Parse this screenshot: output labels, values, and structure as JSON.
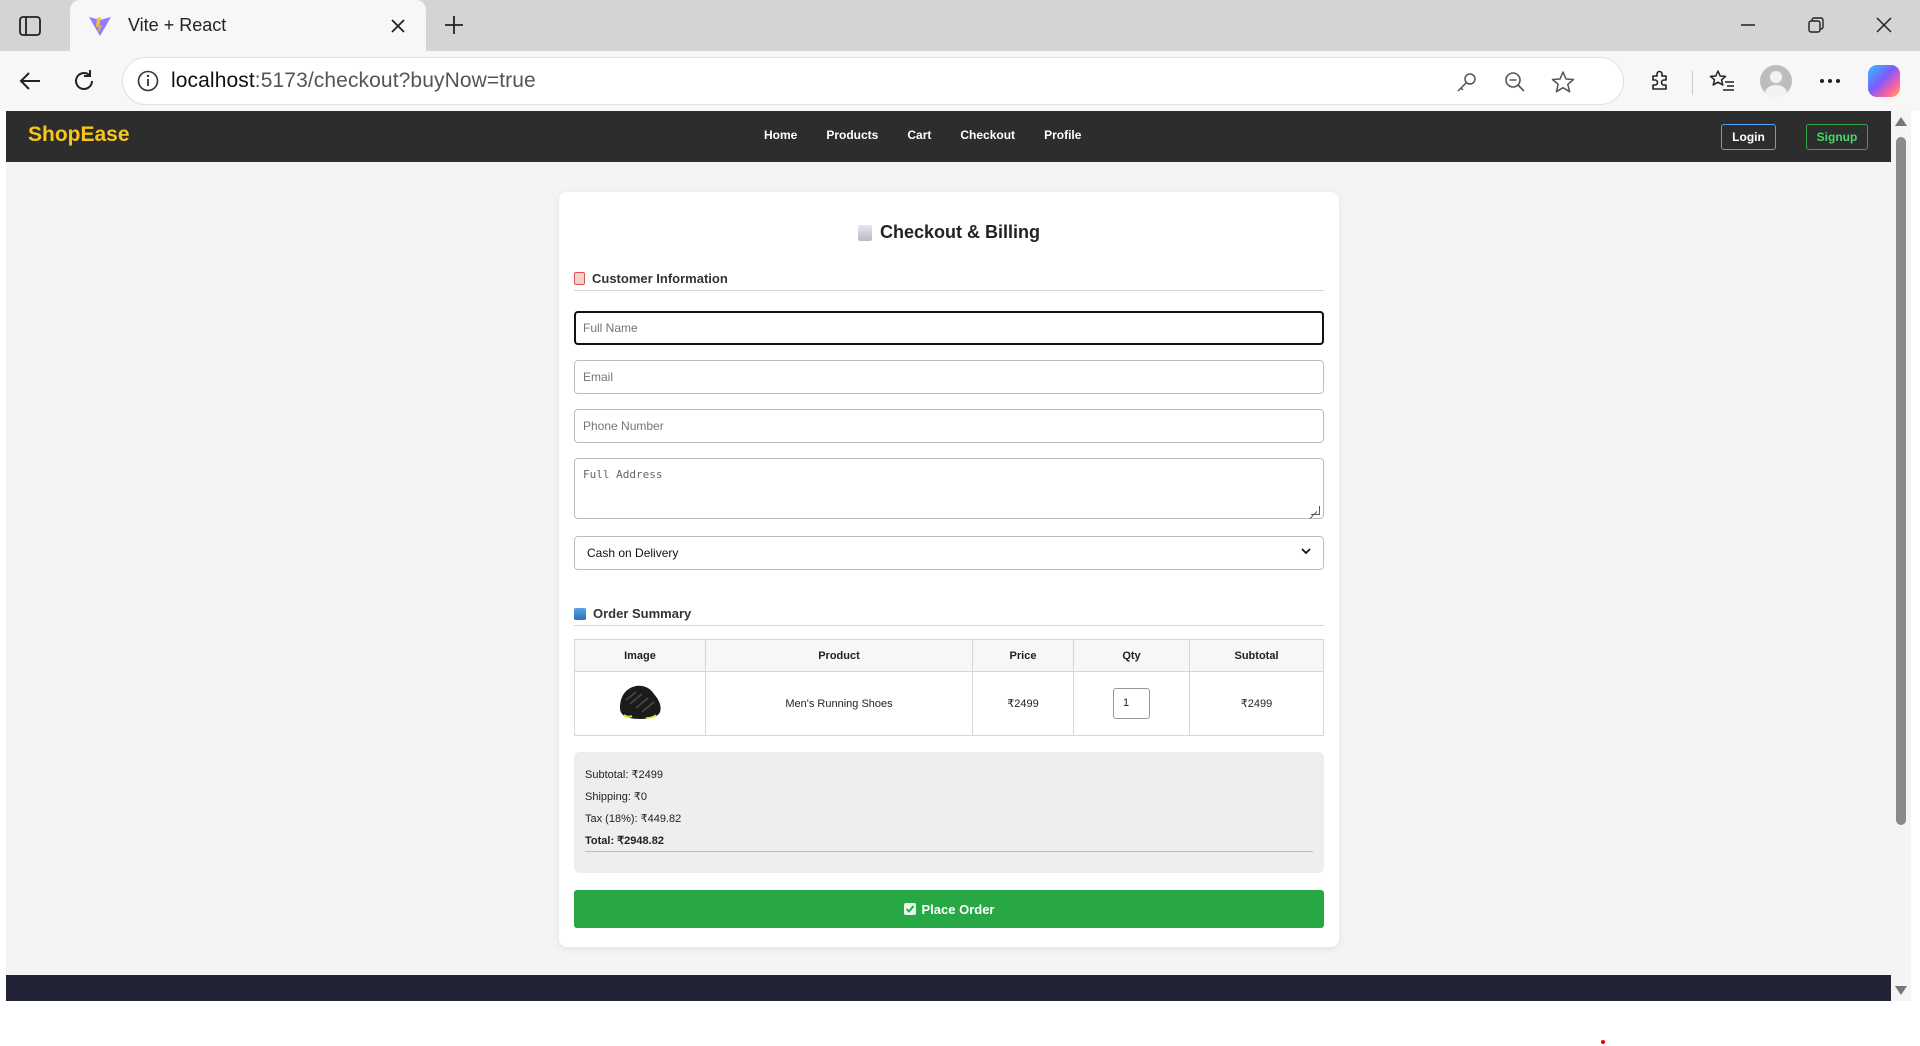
{
  "browser": {
    "tab_title": "Vite + React",
    "url_host": "localhost",
    "url_rest": ":5173/checkout?buyNow=true"
  },
  "site": {
    "brand": "ShopEase",
    "nav": [
      "Home",
      "Products",
      "Cart",
      "Checkout",
      "Profile"
    ],
    "login_label": "Login",
    "signup_label": "Signup",
    "brand_color": "#f7c51d",
    "nav_bg": "#2d2d2d"
  },
  "checkout": {
    "title": "Checkout & Billing",
    "customer_section": "Customer Information",
    "fields": {
      "name_placeholder": "Full Name",
      "email_placeholder": "Email",
      "phone_placeholder": "Phone Number",
      "address_placeholder": "Full Address",
      "payment_selected": "Cash on Delivery"
    },
    "order_section": "Order Summary",
    "table": {
      "headers": [
        "Image",
        "Product",
        "Price",
        "Qty",
        "Subtotal"
      ],
      "rows": [
        {
          "product": "Men's Running Shoes",
          "price": "₹2499",
          "qty": "1",
          "subtotal": "₹2499"
        }
      ]
    },
    "summary": {
      "subtotal": "Subtotal: ₹2499",
      "shipping": "Shipping: ₹0",
      "tax": "Tax (18%): ₹449.82",
      "total": "Total: ₹2948.82"
    },
    "place_order_label": "Place Order",
    "accent_color": "#28a745"
  }
}
